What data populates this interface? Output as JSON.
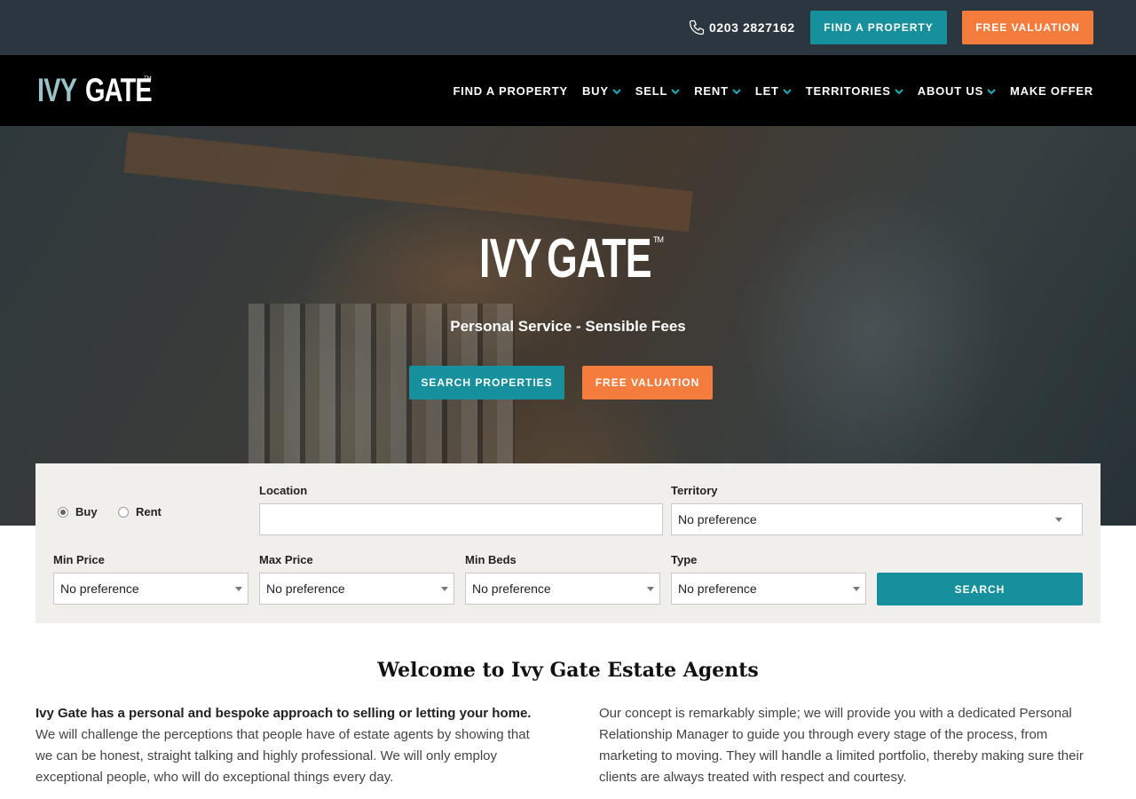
{
  "topbar": {
    "phone": "0203 2827162",
    "find_property": "FIND A PROPERTY",
    "free_valuation": "FREE VALUATION"
  },
  "brand": {
    "ivy": "IVY",
    "gate": "GATE",
    "tm": "TM"
  },
  "nav": {
    "items": [
      {
        "label": "FIND A PROPERTY",
        "dropdown": false
      },
      {
        "label": "BUY",
        "dropdown": true
      },
      {
        "label": "SELL",
        "dropdown": true
      },
      {
        "label": "RENT",
        "dropdown": true
      },
      {
        "label": "LET",
        "dropdown": true
      },
      {
        "label": "TERRITORIES",
        "dropdown": true
      },
      {
        "label": "ABOUT US",
        "dropdown": true
      },
      {
        "label": "MAKE OFFER",
        "dropdown": false
      }
    ]
  },
  "hero": {
    "tagline": "Personal Service - Sensible Fees",
    "search_button": "SEARCH PROPERTIES",
    "valuation_button": "FREE VALUATION"
  },
  "search": {
    "radio_buy": "Buy",
    "radio_rent": "Rent",
    "selected_mode": "Buy",
    "location_label": "Location",
    "location_value": "",
    "territory_label": "Territory",
    "territory_value": "No preference",
    "min_price_label": "Min Price",
    "min_price_value": "No preference",
    "max_price_label": "Max Price",
    "max_price_value": "No preference",
    "min_beds_label": "Min Beds",
    "min_beds_value": "No preference",
    "type_label": "Type",
    "type_value": "No preference",
    "search_button": "SEARCH"
  },
  "welcome": {
    "heading": "Welcome to Ivy Gate Estate Agents",
    "left_lead": "Ivy Gate has a personal and bespoke approach to selling or letting your home.",
    "left_body": "We will challenge the perceptions that people have of estate agents by showing that we can be honest, straight talking and highly professional. We will only employ exceptional people, who will do exceptional things every day.",
    "right_body": "Our concept is remarkably simple; we will provide you with a dedicated Personal Relationship Manager to guide you through every stage of the process, from marketing to moving. They will handle a limited portfolio, thereby making sure their clients are always treated with respect and courtesy."
  },
  "colors": {
    "topbar_bg": "#2b3640",
    "nav_bg": "#000000",
    "teal": "#17909e",
    "orange": "#f47c3c",
    "panel_bg": "#f0efeb"
  }
}
